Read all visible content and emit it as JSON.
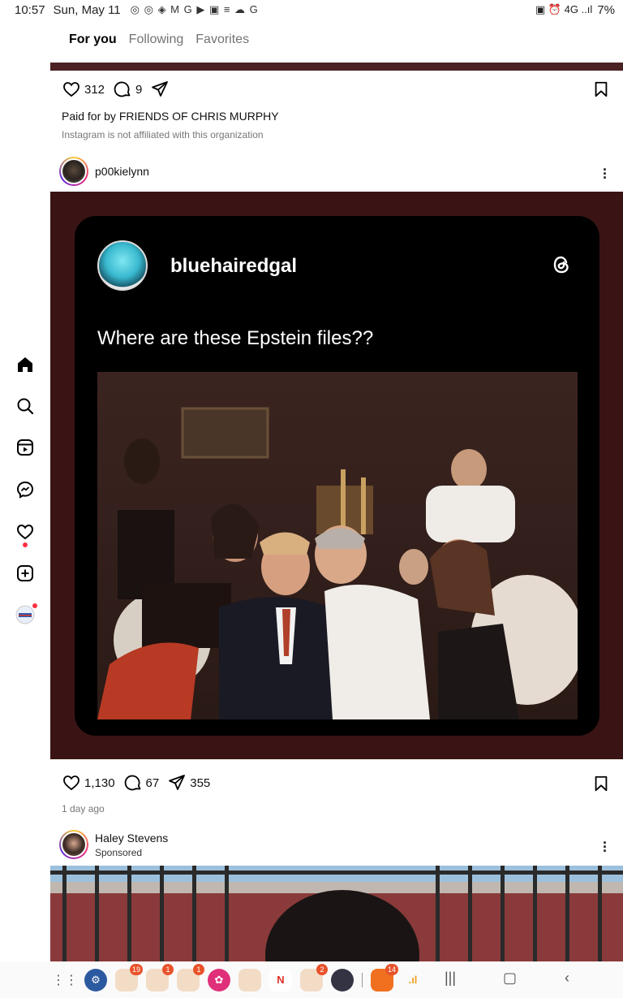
{
  "status": {
    "time": "10:57",
    "date": "Sun, May 11",
    "notif_icons": "◎ ◎ ◈ M G   ▶ ▣ ≡ ☁ G",
    "right_icons": "▣ ⏰ 4G ..ıl",
    "battery": "7%"
  },
  "tabs": [
    "For you",
    "Following",
    "Favorites"
  ],
  "post1": {
    "likes": "312",
    "comments": "9",
    "paid": "Paid for by FRIENDS OF CHRIS MURPHY",
    "disclaimer": "Instagram is not affiliated with this organization"
  },
  "post2": {
    "username": "p00kielynn",
    "card": {
      "username": "bluehairedgal",
      "text": "Where are these Epstein files??"
    },
    "likes": "1,130",
    "comments": "67",
    "shares": "355",
    "time": "1 day ago"
  },
  "post3": {
    "username": "Haley Stevens",
    "sponsored": "Sponsored"
  },
  "navbar": {
    "badges": [
      "19",
      "1",
      "1",
      "2",
      "14"
    ]
  },
  "colors": {
    "post_bg": "#3a1414",
    "card_bg": "#000000",
    "accent_badge": "#e8522a"
  }
}
